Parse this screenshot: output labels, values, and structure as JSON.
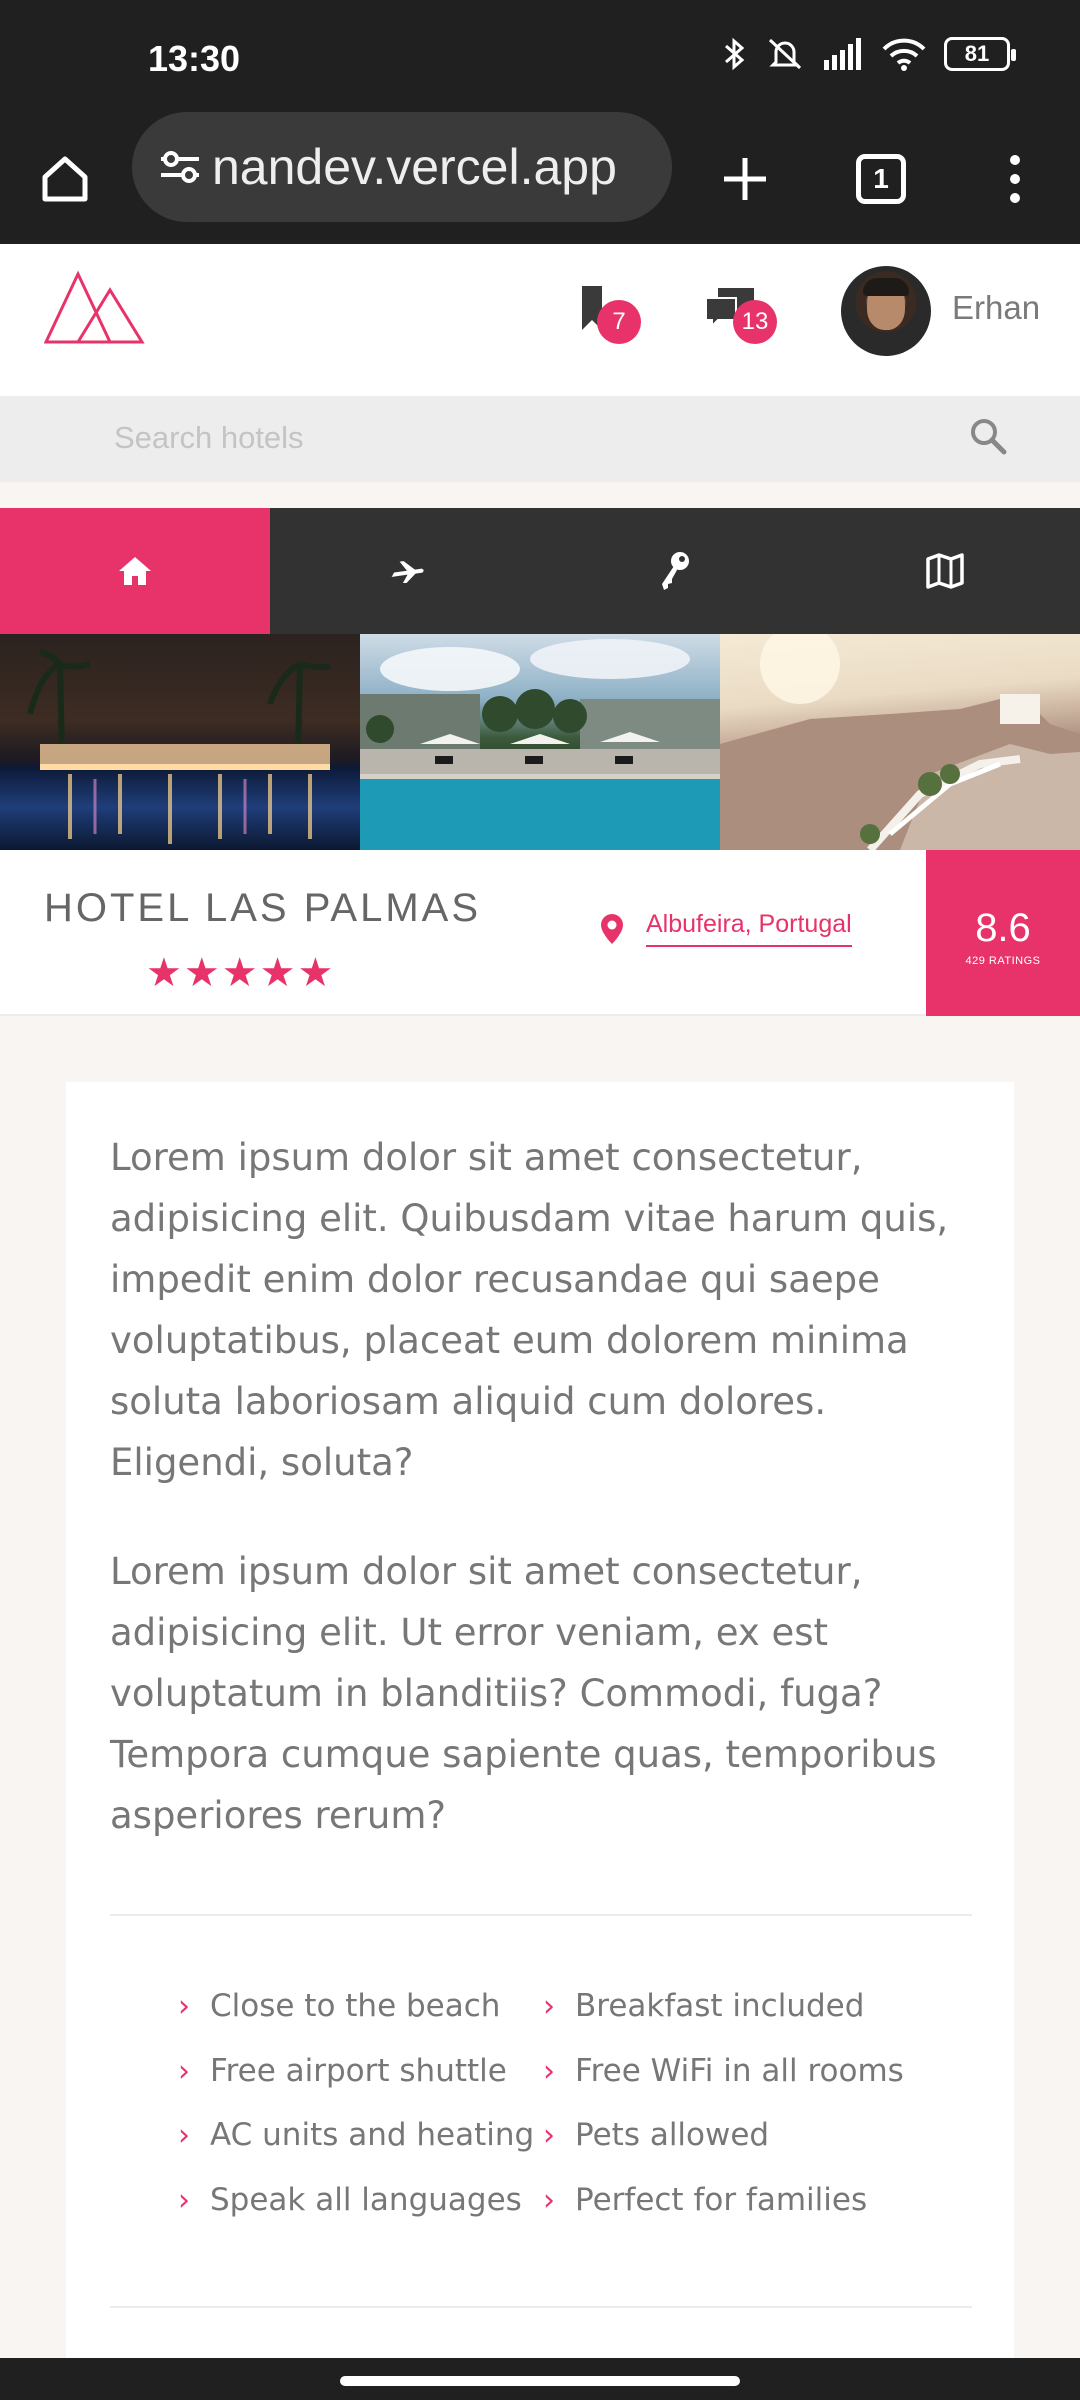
{
  "status": {
    "time": "13:30",
    "battery": "81"
  },
  "browser": {
    "url": "nandev.vercel.app",
    "tab_count": "1"
  },
  "header": {
    "bookmarks_count": "7",
    "messages_count": "13",
    "user_name": "Erhan",
    "brand_color": "#e8336a"
  },
  "search": {
    "placeholder": "Search hotels"
  },
  "tabs": [
    {
      "name": "home-icon",
      "active": true
    },
    {
      "name": "plane-icon",
      "active": false
    },
    {
      "name": "key-icon",
      "active": false
    },
    {
      "name": "map-icon",
      "active": false
    }
  ],
  "hotel": {
    "name": "HOTEL LAS PALMAS",
    "stars": "★★★★★",
    "location": "Albufeira, Portugal",
    "score": "8.6",
    "ratings": "429 RATINGS"
  },
  "description": {
    "p1": "Lorem ipsum dolor sit amet consectetur, adipisicing elit. Quibusdam vitae harum quis, impedit enim dolor recusandae qui saepe voluptatibus, placeat eum dolorem minima soluta laboriosam aliquid cum dolores. Eligendi, soluta?",
    "p2": "Lorem ipsum dolor sit amet consectetur, adipisicing elit. Ut error veniam, ex est voluptatum in blanditiis? Commodi, fuga? Tempora cumque sapiente quas, temporibus asperiores rerum?"
  },
  "features": {
    "left": [
      "Close to the beach",
      "Free airport shuttle",
      "AC units and heating",
      "Speak all languages"
    ],
    "right": [
      "Breakfast included",
      "Free WiFi in all rooms",
      "Pets allowed",
      "Perfect for families"
    ]
  }
}
